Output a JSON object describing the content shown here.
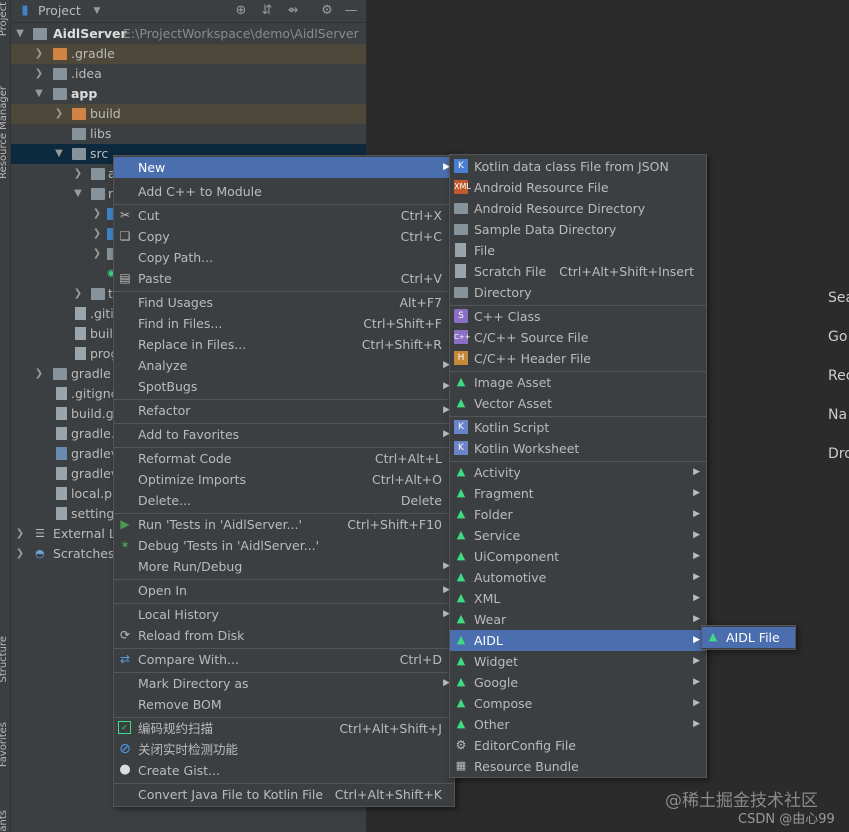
{
  "tool_stripe": {
    "top_labels": [
      "Project",
      "Resource Manager"
    ],
    "bottom_labels": [
      "Structure",
      "Favorites",
      "ants"
    ]
  },
  "project_panel": {
    "title": "Project",
    "tree": [
      {
        "label": "AidlServer",
        "extra": "E:\\ProjectWorkspace\\demo\\AidlServer",
        "bold": true
      },
      {
        "label": ".gradle"
      },
      {
        "label": ".idea"
      },
      {
        "label": "app",
        "bold": true
      },
      {
        "label": "build"
      },
      {
        "label": "libs"
      },
      {
        "label": "src"
      },
      {
        "label": "a"
      },
      {
        "label": "r"
      },
      {
        "label": ""
      },
      {
        "label": ""
      },
      {
        "label": ""
      },
      {
        "label": "t"
      },
      {
        "label": ".giti"
      },
      {
        "label": "buil"
      },
      {
        "label": "prog"
      },
      {
        "label": "gradle"
      },
      {
        "label": ".gitignc"
      },
      {
        "label": "build.g"
      },
      {
        "label": "gradle."
      },
      {
        "label": "gradlev"
      },
      {
        "label": "gradlev"
      },
      {
        "label": "local.pr"
      },
      {
        "label": "settings"
      },
      {
        "label": "External Li"
      },
      {
        "label": "Scratches"
      }
    ]
  },
  "editor_hints": [
    "Sea",
    "Go",
    "Rec",
    "Na",
    "Dro"
  ],
  "context_menu": [
    {
      "label": "New",
      "submenu": true,
      "selected": true
    },
    {
      "label": "Add C++ to Module"
    },
    {
      "label": "Cut",
      "shortcut": "Ctrl+X",
      "icon": "cut-icon"
    },
    {
      "label": "Copy",
      "shortcut": "Ctrl+C",
      "icon": "copy-icon"
    },
    {
      "label": "Copy Path..."
    },
    {
      "label": "Paste",
      "shortcut": "Ctrl+V",
      "icon": "paste-icon"
    },
    {
      "label": "Find Usages",
      "shortcut": "Alt+F7"
    },
    {
      "label": "Find in Files...",
      "shortcut": "Ctrl+Shift+F"
    },
    {
      "label": "Replace in Files...",
      "shortcut": "Ctrl+Shift+R"
    },
    {
      "label": "Analyze",
      "submenu": true
    },
    {
      "label": "SpotBugs",
      "submenu": true
    },
    {
      "label": "Refactor",
      "submenu": true
    },
    {
      "label": "Add to Favorites",
      "submenu": true
    },
    {
      "label": "Reformat Code",
      "shortcut": "Ctrl+Alt+L"
    },
    {
      "label": "Optimize Imports",
      "shortcut": "Ctrl+Alt+O"
    },
    {
      "label": "Delete...",
      "shortcut": "Delete"
    },
    {
      "label": "Run 'Tests in 'AidlServer...'",
      "shortcut": "Ctrl+Shift+F10",
      "icon": "run-icon"
    },
    {
      "label": "Debug 'Tests in 'AidlServer...'",
      "icon": "debug-icon"
    },
    {
      "label": "More Run/Debug",
      "submenu": true
    },
    {
      "label": "Open In",
      "submenu": true
    },
    {
      "label": "Local History",
      "submenu": true
    },
    {
      "label": "Reload from Disk",
      "icon": "reload-icon"
    },
    {
      "label": "Compare With...",
      "shortcut": "Ctrl+D",
      "icon": "compare-icon"
    },
    {
      "label": "Mark Directory as",
      "submenu": true
    },
    {
      "label": "Remove BOM"
    },
    {
      "label": "编码规约扫描",
      "shortcut": "Ctrl+Alt+Shift+J",
      "icon": "scan-icon"
    },
    {
      "label": "关闭实时检测功能",
      "icon": "disable-icon"
    },
    {
      "label": "Create Gist...",
      "icon": "github-icon"
    },
    {
      "label": "Convert Java File to Kotlin File",
      "shortcut": "Ctrl+Alt+Shift+K"
    }
  ],
  "new_submenu": [
    {
      "label": "Kotlin data class File from JSON",
      "icon": "kotlin-json-icon"
    },
    {
      "label": "Android Resource File",
      "icon": "resource-file-icon"
    },
    {
      "label": "Android Resource Directory",
      "icon": "folder-icon"
    },
    {
      "label": "Sample Data Directory",
      "icon": "folder-icon"
    },
    {
      "label": "File",
      "icon": "file-icon"
    },
    {
      "label": "Scratch File",
      "shortcut": "Ctrl+Alt+Shift+Insert",
      "icon": "scratch-icon"
    },
    {
      "label": "Directory",
      "icon": "folder-icon"
    },
    {
      "label": "C++ Class",
      "icon": "cpp-class-icon"
    },
    {
      "label": "C/C++ Source File",
      "icon": "cpp-source-icon"
    },
    {
      "label": "C/C++ Header File",
      "icon": "cpp-header-icon"
    },
    {
      "label": "Image Asset",
      "icon": "android-icon"
    },
    {
      "label": "Vector Asset",
      "icon": "android-icon"
    },
    {
      "label": "Kotlin Script",
      "icon": "kotlin-script-icon"
    },
    {
      "label": "Kotlin Worksheet",
      "icon": "kotlin-script-icon"
    },
    {
      "label": "Activity",
      "submenu": true,
      "icon": "android-icon"
    },
    {
      "label": "Fragment",
      "submenu": true,
      "icon": "android-icon"
    },
    {
      "label": "Folder",
      "submenu": true,
      "icon": "android-icon"
    },
    {
      "label": "Service",
      "submenu": true,
      "icon": "android-icon"
    },
    {
      "label": "UiComponent",
      "submenu": true,
      "icon": "android-icon"
    },
    {
      "label": "Automotive",
      "submenu": true,
      "icon": "android-icon"
    },
    {
      "label": "XML",
      "submenu": true,
      "icon": "android-icon"
    },
    {
      "label": "Wear",
      "submenu": true,
      "icon": "android-icon"
    },
    {
      "label": "AIDL",
      "submenu": true,
      "selected": true,
      "icon": "android-icon"
    },
    {
      "label": "Widget",
      "submenu": true,
      "icon": "android-icon"
    },
    {
      "label": "Google",
      "submenu": true,
      "icon": "android-icon"
    },
    {
      "label": "Compose",
      "submenu": true,
      "icon": "android-icon"
    },
    {
      "label": "Other",
      "submenu": true,
      "icon": "android-icon"
    },
    {
      "label": "EditorConfig File",
      "icon": "gear-icon"
    },
    {
      "label": "Resource Bundle",
      "icon": "bundle-icon"
    }
  ],
  "aidl_submenu": [
    {
      "label": "AIDL File",
      "selected": true,
      "icon": "android-icon"
    }
  ],
  "watermark": "@稀土掘金技术社区",
  "credit": "CSDN @由心99",
  "colors": {
    "selection": "#4b6eaf",
    "menu_bg": "#3c3f41",
    "editor_bg": "#2b2b2b",
    "android_green": "#3ddc84"
  }
}
